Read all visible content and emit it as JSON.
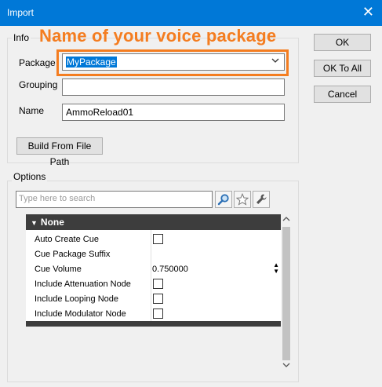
{
  "window": {
    "title": "Import",
    "close_glyph": "✕"
  },
  "annotation": {
    "text": "Name of your voice package",
    "color": "#f47d20"
  },
  "info": {
    "group_label": "Info",
    "package_label": "Package",
    "package_value": "MyPackage",
    "grouping_label": "Grouping",
    "grouping_value": "",
    "name_label": "Name",
    "name_value": "AmmoReload01",
    "build_button": "Build From File Path"
  },
  "buttons": {
    "ok": "OK",
    "ok_to_all": "OK To All",
    "cancel": "Cancel"
  },
  "options": {
    "group_label": "Options",
    "search_placeholder": "Type here to search",
    "section_title": "None",
    "properties": [
      {
        "name": "Auto Create Cue",
        "type": "checkbox",
        "checked": false
      },
      {
        "name": "Cue Package Suffix",
        "type": "text",
        "value": ""
      },
      {
        "name": "Cue Volume",
        "type": "number",
        "value": "0.750000"
      },
      {
        "name": "Include Attenuation Node",
        "type": "checkbox",
        "checked": false
      },
      {
        "name": "Include Looping Node",
        "type": "checkbox",
        "checked": false
      },
      {
        "name": "Include Modulator Node",
        "type": "checkbox",
        "checked": false
      }
    ]
  },
  "icons": {
    "close": "close-icon",
    "dropdown": "chevron-down-icon",
    "search": "search-icon",
    "favorite": "star-icon",
    "settings": "settings-icon"
  },
  "colors": {
    "title_bar": "#0078d7",
    "highlight": "#f47d20",
    "grid_header": "#3d3d3d"
  }
}
